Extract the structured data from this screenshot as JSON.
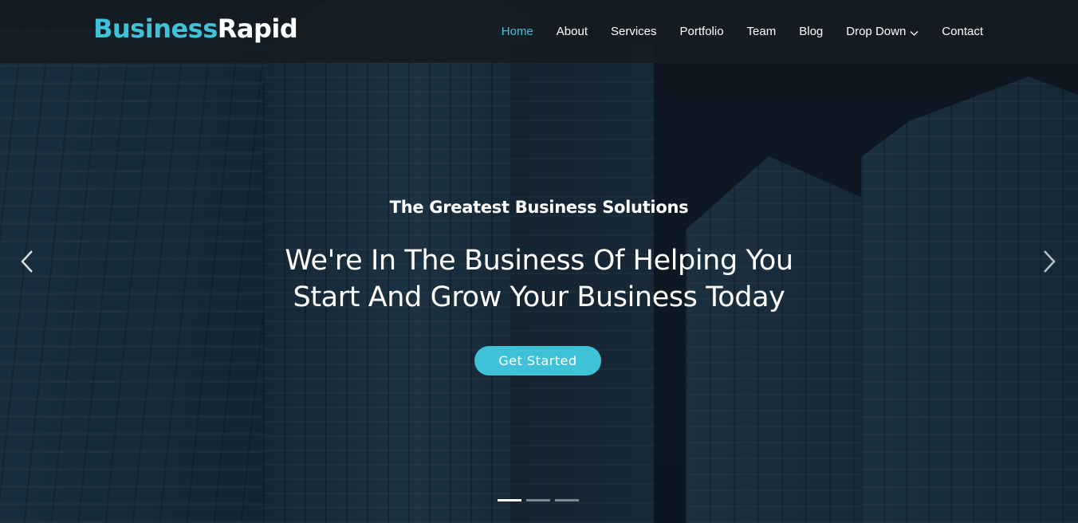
{
  "brand": {
    "part1": "Business",
    "part2": "Rapid",
    "accent_color": "#3fc1d8"
  },
  "nav": {
    "items": [
      {
        "label": "Home",
        "active": true
      },
      {
        "label": "About",
        "active": false
      },
      {
        "label": "Services",
        "active": false
      },
      {
        "label": "Portfolio",
        "active": false
      },
      {
        "label": "Team",
        "active": false
      },
      {
        "label": "Blog",
        "active": false
      },
      {
        "label": "Drop Down",
        "active": false,
        "icon": "chevron-down-icon"
      },
      {
        "label": "Contact",
        "active": false
      }
    ]
  },
  "hero": {
    "subtitle": "The Greatest Business Solutions",
    "title_line1": "We're In The Business Of Helping You",
    "title_line2": "Start And Grow Your Business Today",
    "cta_label": "Get Started",
    "prev_icon": "chevron-left-icon",
    "next_icon": "chevron-right-icon",
    "slides": {
      "count": 3,
      "active_index": 0
    }
  }
}
